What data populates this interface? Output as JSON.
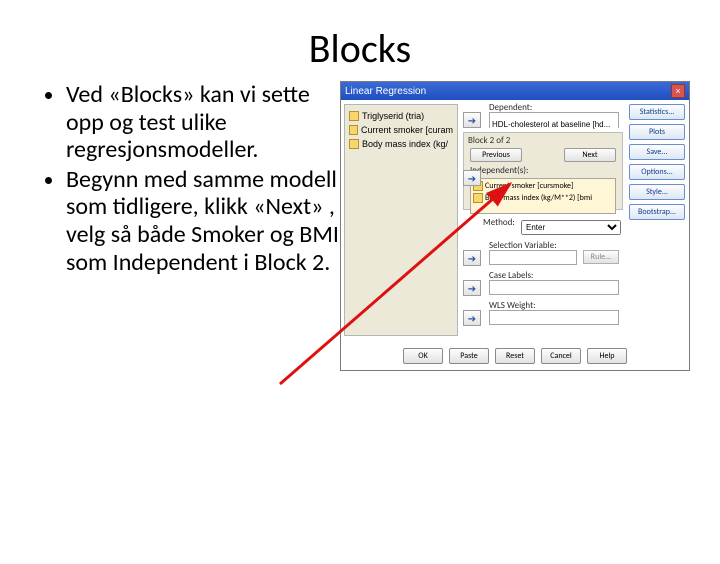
{
  "title": "Blocks",
  "bullets": [
    "Ved «Blocks» kan vi sette opp og test ulike regresjonsmodeller.",
    "Begynn med samme modell som tidligere, klikk «Next» , velg så både Smoker og BMI som Independent i Block 2."
  ],
  "dlg": {
    "title": "Linear Regression",
    "close": "×",
    "vars": [
      "Triglyserid (tria)",
      "Current smoker [curam",
      "Body mass index (kg/"
    ],
    "dep_label": "Dependent:",
    "dep_value": "HDL-cholesterol at baseline [hd...",
    "block_label": "Block 2 of 2",
    "prev": "Previous",
    "next": "Next",
    "indep_label": "Independent(s):",
    "indep": [
      "Current smoker [cursmoke]",
      "Body mass index (kg/M**2) [bmi"
    ],
    "method_label": "Method:",
    "method_value": "Enter",
    "sel_label": "Selection Variable:",
    "rule": "Rule...",
    "case_label": "Case Labels:",
    "wls_label": "WLS Weight:",
    "side": [
      "Statistics...",
      "Plots",
      "Save...",
      "Options...",
      "Style...",
      "Bootstrap..."
    ],
    "bottom": [
      "OK",
      "Paste",
      "Reset",
      "Cancel",
      "Help"
    ]
  }
}
